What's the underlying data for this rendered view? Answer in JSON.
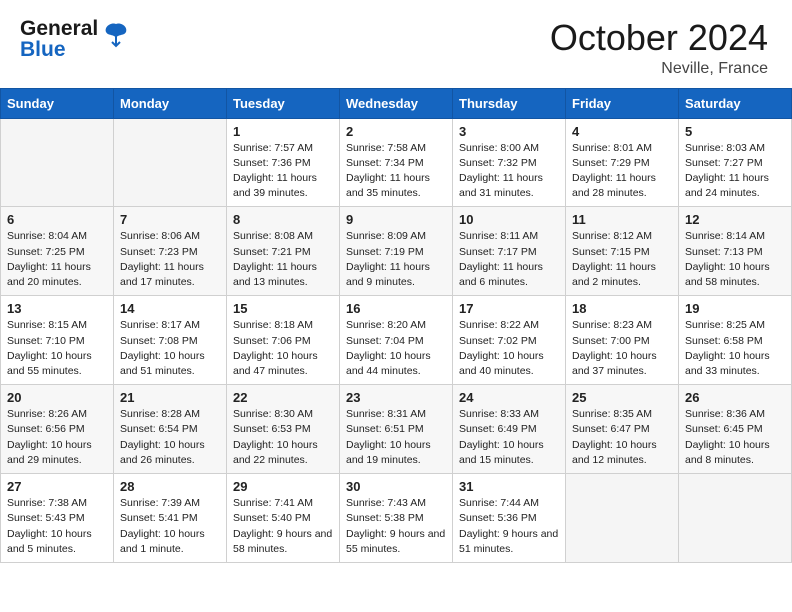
{
  "header": {
    "logo_line1": "General",
    "logo_line2": "Blue",
    "month": "October 2024",
    "location": "Neville, France"
  },
  "weekdays": [
    "Sunday",
    "Monday",
    "Tuesday",
    "Wednesday",
    "Thursday",
    "Friday",
    "Saturday"
  ],
  "weeks": [
    [
      {
        "day": "",
        "info": ""
      },
      {
        "day": "",
        "info": ""
      },
      {
        "day": "1",
        "info": "Sunrise: 7:57 AM\nSunset: 7:36 PM\nDaylight: 11 hours and 39 minutes."
      },
      {
        "day": "2",
        "info": "Sunrise: 7:58 AM\nSunset: 7:34 PM\nDaylight: 11 hours and 35 minutes."
      },
      {
        "day": "3",
        "info": "Sunrise: 8:00 AM\nSunset: 7:32 PM\nDaylight: 11 hours and 31 minutes."
      },
      {
        "day": "4",
        "info": "Sunrise: 8:01 AM\nSunset: 7:29 PM\nDaylight: 11 hours and 28 minutes."
      },
      {
        "day": "5",
        "info": "Sunrise: 8:03 AM\nSunset: 7:27 PM\nDaylight: 11 hours and 24 minutes."
      }
    ],
    [
      {
        "day": "6",
        "info": "Sunrise: 8:04 AM\nSunset: 7:25 PM\nDaylight: 11 hours and 20 minutes."
      },
      {
        "day": "7",
        "info": "Sunrise: 8:06 AM\nSunset: 7:23 PM\nDaylight: 11 hours and 17 minutes."
      },
      {
        "day": "8",
        "info": "Sunrise: 8:08 AM\nSunset: 7:21 PM\nDaylight: 11 hours and 13 minutes."
      },
      {
        "day": "9",
        "info": "Sunrise: 8:09 AM\nSunset: 7:19 PM\nDaylight: 11 hours and 9 minutes."
      },
      {
        "day": "10",
        "info": "Sunrise: 8:11 AM\nSunset: 7:17 PM\nDaylight: 11 hours and 6 minutes."
      },
      {
        "day": "11",
        "info": "Sunrise: 8:12 AM\nSunset: 7:15 PM\nDaylight: 11 hours and 2 minutes."
      },
      {
        "day": "12",
        "info": "Sunrise: 8:14 AM\nSunset: 7:13 PM\nDaylight: 10 hours and 58 minutes."
      }
    ],
    [
      {
        "day": "13",
        "info": "Sunrise: 8:15 AM\nSunset: 7:10 PM\nDaylight: 10 hours and 55 minutes."
      },
      {
        "day": "14",
        "info": "Sunrise: 8:17 AM\nSunset: 7:08 PM\nDaylight: 10 hours and 51 minutes."
      },
      {
        "day": "15",
        "info": "Sunrise: 8:18 AM\nSunset: 7:06 PM\nDaylight: 10 hours and 47 minutes."
      },
      {
        "day": "16",
        "info": "Sunrise: 8:20 AM\nSunset: 7:04 PM\nDaylight: 10 hours and 44 minutes."
      },
      {
        "day": "17",
        "info": "Sunrise: 8:22 AM\nSunset: 7:02 PM\nDaylight: 10 hours and 40 minutes."
      },
      {
        "day": "18",
        "info": "Sunrise: 8:23 AM\nSunset: 7:00 PM\nDaylight: 10 hours and 37 minutes."
      },
      {
        "day": "19",
        "info": "Sunrise: 8:25 AM\nSunset: 6:58 PM\nDaylight: 10 hours and 33 minutes."
      }
    ],
    [
      {
        "day": "20",
        "info": "Sunrise: 8:26 AM\nSunset: 6:56 PM\nDaylight: 10 hours and 29 minutes."
      },
      {
        "day": "21",
        "info": "Sunrise: 8:28 AM\nSunset: 6:54 PM\nDaylight: 10 hours and 26 minutes."
      },
      {
        "day": "22",
        "info": "Sunrise: 8:30 AM\nSunset: 6:53 PM\nDaylight: 10 hours and 22 minutes."
      },
      {
        "day": "23",
        "info": "Sunrise: 8:31 AM\nSunset: 6:51 PM\nDaylight: 10 hours and 19 minutes."
      },
      {
        "day": "24",
        "info": "Sunrise: 8:33 AM\nSunset: 6:49 PM\nDaylight: 10 hours and 15 minutes."
      },
      {
        "day": "25",
        "info": "Sunrise: 8:35 AM\nSunset: 6:47 PM\nDaylight: 10 hours and 12 minutes."
      },
      {
        "day": "26",
        "info": "Sunrise: 8:36 AM\nSunset: 6:45 PM\nDaylight: 10 hours and 8 minutes."
      }
    ],
    [
      {
        "day": "27",
        "info": "Sunrise: 7:38 AM\nSunset: 5:43 PM\nDaylight: 10 hours and 5 minutes."
      },
      {
        "day": "28",
        "info": "Sunrise: 7:39 AM\nSunset: 5:41 PM\nDaylight: 10 hours and 1 minute."
      },
      {
        "day": "29",
        "info": "Sunrise: 7:41 AM\nSunset: 5:40 PM\nDaylight: 9 hours and 58 minutes."
      },
      {
        "day": "30",
        "info": "Sunrise: 7:43 AM\nSunset: 5:38 PM\nDaylight: 9 hours and 55 minutes."
      },
      {
        "day": "31",
        "info": "Sunrise: 7:44 AM\nSunset: 5:36 PM\nDaylight: 9 hours and 51 minutes."
      },
      {
        "day": "",
        "info": ""
      },
      {
        "day": "",
        "info": ""
      }
    ]
  ]
}
